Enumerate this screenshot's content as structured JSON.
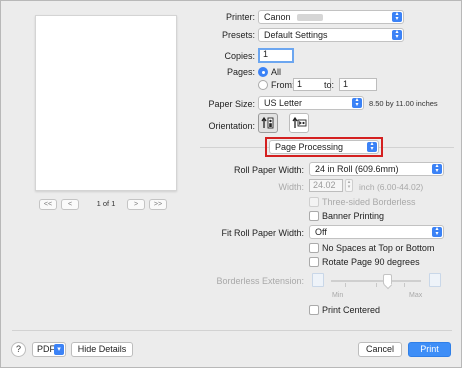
{
  "preview": {
    "page_info": "1 of 1",
    "first_label": "<<",
    "prev_label": "<",
    "next_label": ">",
    "last_label": ">>"
  },
  "printer": {
    "label": "Printer:",
    "value": "Canon"
  },
  "presets": {
    "label": "Presets:",
    "value": "Default Settings"
  },
  "copies": {
    "label": "Copies:",
    "value": "1"
  },
  "pages": {
    "label": "Pages:",
    "all_label": "All",
    "from_label": "From:",
    "from_value": "1",
    "to_label": "to:",
    "to_value": "1"
  },
  "paper_size": {
    "label": "Paper Size:",
    "value": "US Letter",
    "dimensions": "8.50 by 11.00 inches"
  },
  "orientation": {
    "label": "Orientation:"
  },
  "panel_select": {
    "value": "Page Processing"
  },
  "roll_paper_width": {
    "label": "Roll Paper Width:",
    "value": "24 in Roll (609.6mm)"
  },
  "width": {
    "label": "Width:",
    "value": "24.02",
    "unit": "inch (6.00-44.02)"
  },
  "three_sided": {
    "label": "Three-sided Borderless"
  },
  "banner_printing": {
    "label": "Banner Printing"
  },
  "fit_roll": {
    "label": "Fit Roll Paper Width:",
    "value": "Off"
  },
  "no_spaces": {
    "label": "No Spaces at Top or Bottom"
  },
  "rotate_page": {
    "label": "Rotate Page 90 degrees"
  },
  "borderless_ext": {
    "label": "Borderless Extension:",
    "min_label": "Min",
    "max_label": "Max"
  },
  "print_centered": {
    "label": "Print Centered"
  },
  "footer": {
    "help": "?",
    "pdf": "PDF",
    "hide_details": "Hide Details",
    "cancel": "Cancel",
    "print": "Print"
  },
  "colors": {
    "accent": "#3b82f6",
    "highlight_border": "#d42020",
    "background": "#ececec"
  }
}
